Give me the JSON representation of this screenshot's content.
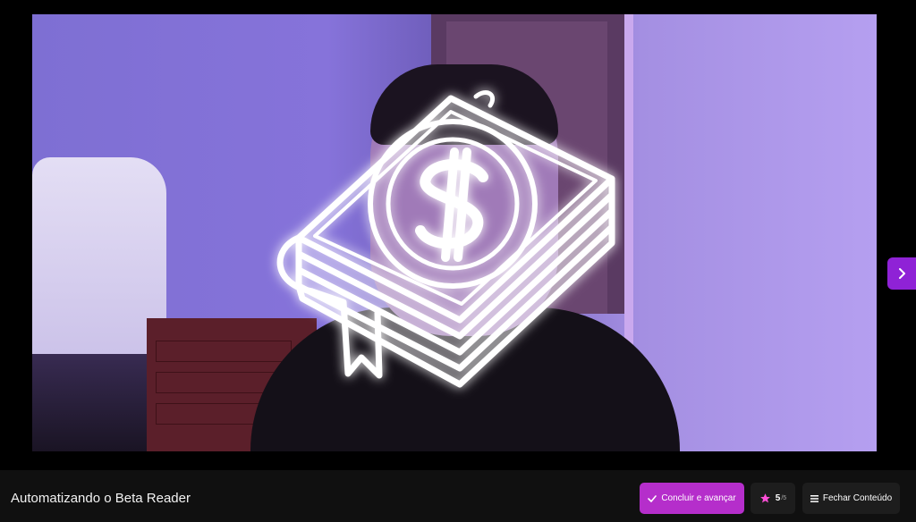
{
  "player": {
    "overlay_icon": "money-book-icon",
    "next_icon": "chevron-right-icon"
  },
  "footer": {
    "lesson_title": "Automatizando o Beta Reader",
    "complete_label": "Concluir e avançar",
    "complete_icon": "check-icon",
    "rating_value": "5",
    "rating_max": "/5",
    "rating_icon": "star-icon",
    "close_label": "Fechar Conteúdo",
    "close_icon": "menu-icon"
  },
  "colors": {
    "accent": "#b52ecb",
    "next_button": "#8f22d6",
    "star": "#ff4fd8",
    "bar_background": "#101010"
  }
}
